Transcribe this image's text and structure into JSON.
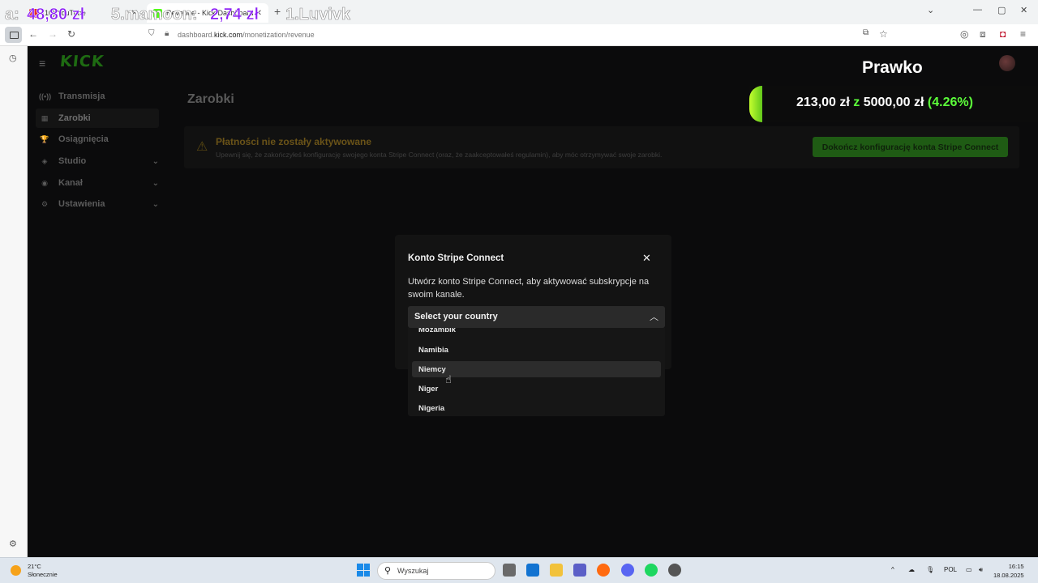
{
  "browser": {
    "tabs": [
      {
        "label": "(10) YouTube",
        "active": false
      },
      {
        "label": "Revenue - Kick Dashboard",
        "active": true
      }
    ],
    "new_tab": "+",
    "url_prefix": "dashboard.",
    "url_domain": "kick.com",
    "url_path": "/monetization/revenue"
  },
  "overlay": {
    "ticker": [
      {
        "rank": "a:",
        "amount": "48,80 zł"
      },
      {
        "rank": "5.mamoon:",
        "amount": "2,74 zł"
      },
      {
        "rank": "1.Luvivk",
        "amount": ""
      }
    ],
    "goal_title": "Prawko",
    "goal_current": "213,00 zł",
    "goal_connector": "z",
    "goal_target": "5000,00 zł",
    "goal_percent": "(4.26%)",
    "goal_fraction": 0.0426
  },
  "dashboard": {
    "logo": "KICK",
    "nav": [
      {
        "icon": "broadcast-icon",
        "glyph": "((•))",
        "label": "Transmisja",
        "active": false,
        "expandable": false
      },
      {
        "icon": "revenue-icon",
        "glyph": "▦",
        "label": "Zarobki",
        "active": true,
        "expandable": false
      },
      {
        "icon": "trophy-icon",
        "glyph": "🏆",
        "label": "Osiągnięcia",
        "active": false,
        "expandable": false
      },
      {
        "icon": "studio-icon",
        "glyph": "◈",
        "label": "Studio",
        "active": false,
        "expandable": true
      },
      {
        "icon": "channel-icon",
        "glyph": "◉",
        "label": "Kanał",
        "active": false,
        "expandable": true
      },
      {
        "icon": "settings-icon",
        "glyph": "⚙",
        "label": "Ustawienia",
        "active": false,
        "expandable": true
      }
    ],
    "page_title": "Zarobki",
    "alert_title": "Płatności nie zostały aktywowane",
    "alert_text": "Upewnij się, że zakończyłeś konfigurację swojego konta Stripe Connect (oraz, że zaakceptowałeś regulamin), aby móc otrzymywać swoje zarobki.",
    "cta_label": "Dokończ konfigurację konta Stripe Connect"
  },
  "modal": {
    "title": "Konto Stripe Connect",
    "description": "Utwórz konto Stripe Connect, aby aktywować subskrypcje na swoim kanale.",
    "select_placeholder": "Select your country",
    "options": [
      "Mozambik",
      "Namibia",
      "Niemcy",
      "Niger",
      "Nigeria"
    ],
    "highlighted": "Niemcy"
  },
  "taskbar": {
    "temperature": "21°C",
    "weather": "Słonecznie",
    "search_placeholder": "Wyszukaj",
    "language": "POL",
    "time": "16:15",
    "date": "18.08.2025"
  }
}
